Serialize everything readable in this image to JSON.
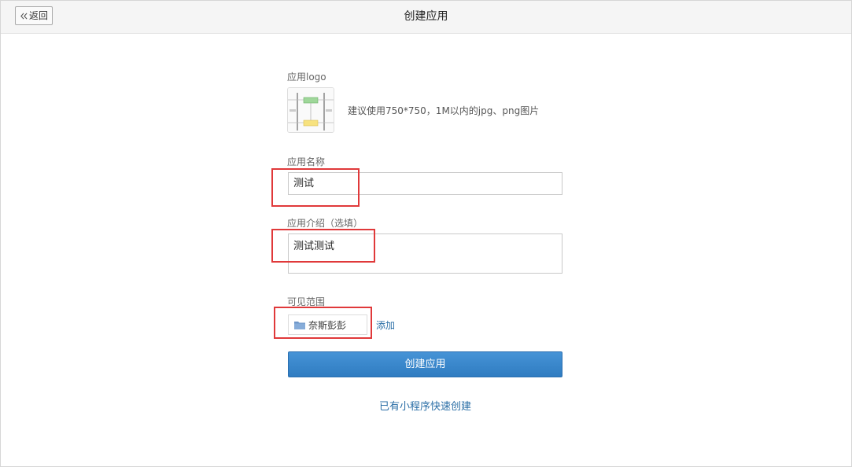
{
  "header": {
    "back_label": "返回",
    "title": "创建应用"
  },
  "form": {
    "logo_label": "应用logo",
    "logo_hint": "建议使用750*750，1M以内的jpg、png图片",
    "name_label": "应用名称",
    "name_value": "测试",
    "intro_label": "应用介绍（选填）",
    "intro_value": "测试测试",
    "scope_label": "可见范围",
    "scope_tag": "奈斯彭彭",
    "scope_add": "添加",
    "submit_label": "创建应用",
    "quick_create": "已有小程序快速创建"
  },
  "colors": {
    "primary": "#3a88cc",
    "link": "#2a6ea6",
    "highlight": "#e0393a"
  },
  "icons": {
    "back": "double-chevron-left-icon",
    "scope": "folder-icon"
  }
}
